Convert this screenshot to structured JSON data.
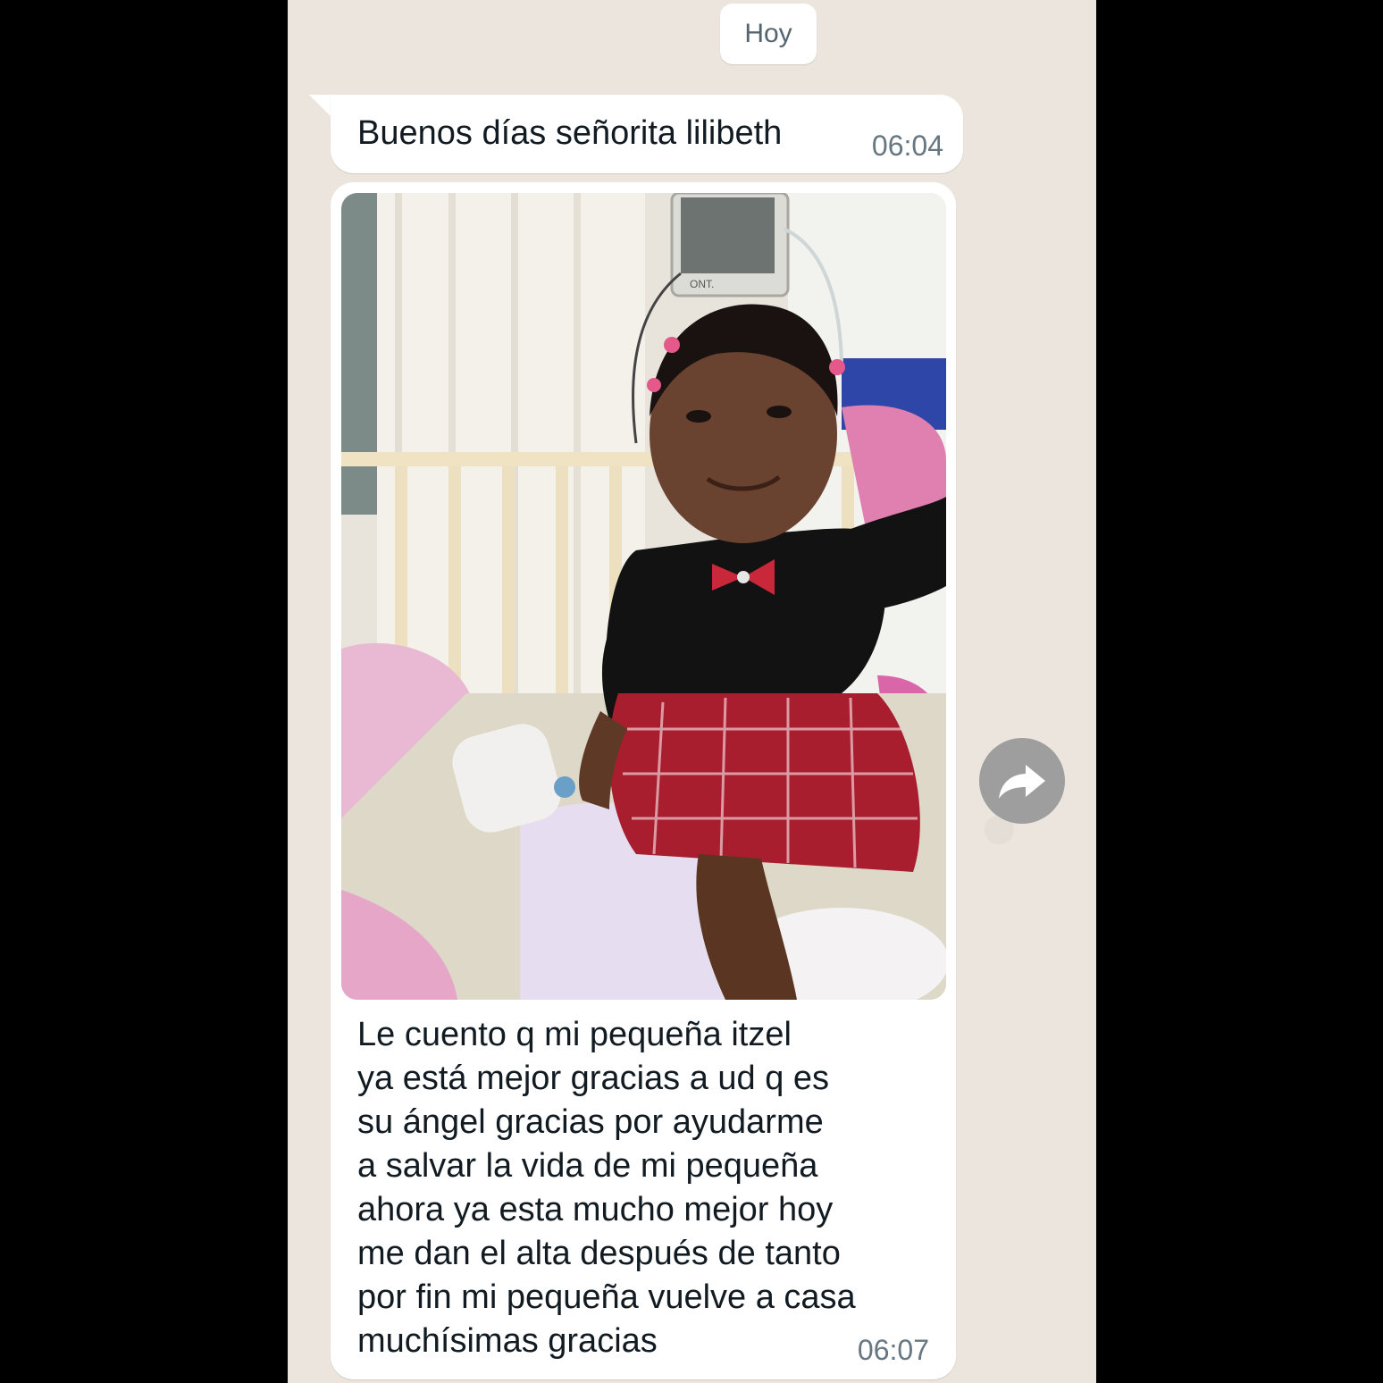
{
  "date_chip": {
    "label": "Hoy"
  },
  "messages": [
    {
      "text": "Buenos días señorita lilibeth",
      "time": "06:04"
    },
    {
      "image": {
        "icon": "photo-of-baby-in-hospital-crib",
        "monitor_label": "ONT."
      },
      "caption": "Le cuento q mi pequeña  itzel\nya está mejor gracias a ud q es\nsu ángel gracias por ayudarme\na salvar la vida de mi pequeña\nahora ya esta mucho mejor hoy\nme dan el alta  después de tanto\npor fin mi pequeña vuelve a casa\nmuchísimas gracias",
      "time": "06:07"
    }
  ],
  "forward_button": {
    "icon": "forward-arrow-icon"
  }
}
